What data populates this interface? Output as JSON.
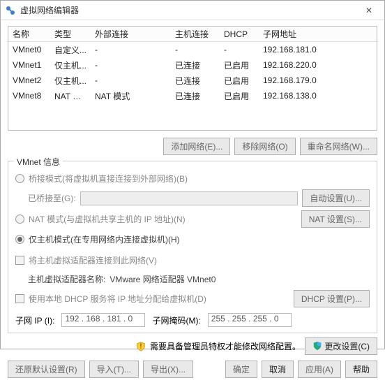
{
  "window": {
    "title": "虚拟网络编辑器",
    "close": "✕"
  },
  "columns": {
    "name": "名称",
    "type": "类型",
    "ext": "外部连接",
    "host": "主机连接",
    "dhcp": "DHCP",
    "subnet": "子网地址"
  },
  "rows": [
    {
      "name": "VMnet0",
      "type": "自定义...",
      "ext": "-",
      "host": "-",
      "dhcp": "-",
      "subnet": "192.168.181.0"
    },
    {
      "name": "VMnet1",
      "type": "仅主机...",
      "ext": "-",
      "host": "已连接",
      "dhcp": "已启用",
      "subnet": "192.168.220.0"
    },
    {
      "name": "VMnet2",
      "type": "仅主机...",
      "ext": "-",
      "host": "已连接",
      "dhcp": "已启用",
      "subnet": "192.168.179.0"
    },
    {
      "name": "VMnet8",
      "type": "NAT 模式",
      "ext": "NAT 模式",
      "host": "已连接",
      "dhcp": "已启用",
      "subnet": "192.168.138.0"
    }
  ],
  "netbtns": {
    "add": "添加网络(E)...",
    "remove": "移除网络(O)",
    "rename": "重命名网络(W)..."
  },
  "group": {
    "legend": "VMnet 信息",
    "bridge": "桥接模式(将虚拟机直接连接到外部网络)(B)",
    "bridge_to": "已桥接至(G):",
    "auto": "自动设置(U)...",
    "nat": "NAT 模式(与虚拟机共享主机的 IP 地址)(N)",
    "nat_btn": "NAT 设置(S)...",
    "hostonly": "仅主机模式(在专用网络内连接虚拟机)(H)",
    "conn_host": "将主机虚拟适配器连接到此网络(V)",
    "adapter_lbl": "主机虚拟适配器名称: ",
    "adapter_val": "VMware 网络适配器 VMnet0",
    "dhcp_chk": "使用本地 DHCP 服务将 IP 地址分配给虚拟机(D)",
    "dhcp_btn": "DHCP 设置(P)..."
  },
  "ip": {
    "subnet_lbl": "子网 IP (I):",
    "subnet_val": "192 . 168 . 181 .  0",
    "mask_lbl": "子网掩码(M):",
    "mask_val": "255 . 255 . 255 .  0"
  },
  "admin": {
    "msg": "需要具备管理员特权才能修改网络配置。",
    "change": "更改设置(C)"
  },
  "footer": {
    "restore": "还原默认设置(R)",
    "import": "导入(T)...",
    "export": "导出(X)...",
    "ok": "确定",
    "cancel": "取消",
    "apply": "应用(A)",
    "help": "帮助"
  }
}
